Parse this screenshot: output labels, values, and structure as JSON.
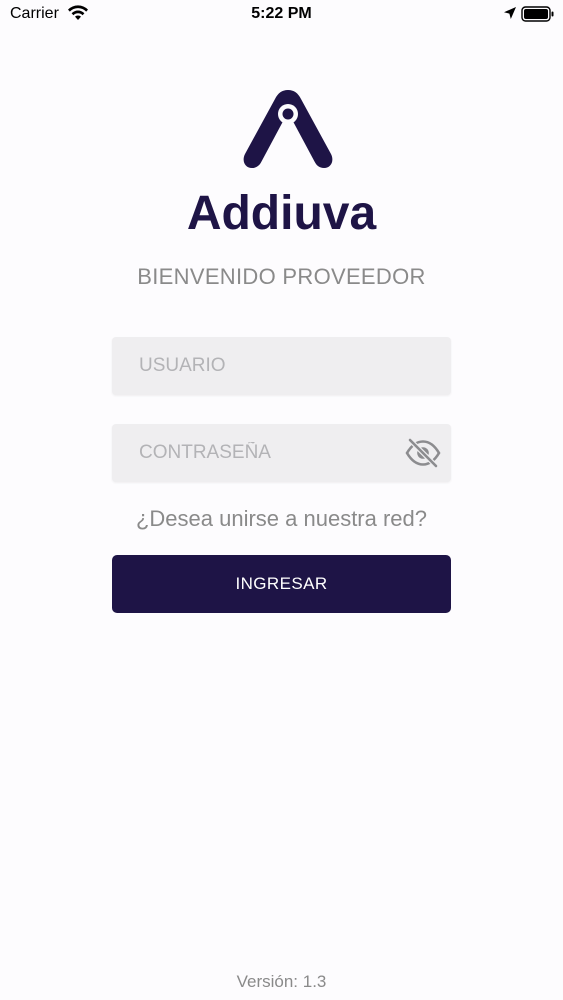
{
  "status_bar": {
    "carrier": "Carrier",
    "time": "5:22 PM",
    "icons": [
      "wifi-icon",
      "location-arrow-icon",
      "battery-icon"
    ]
  },
  "brand": {
    "name": "Addiuva",
    "color": "#1e1446",
    "logo_icon": "addiuva-logo-icon"
  },
  "welcome_text": "BIENVENIDO PROVEEDOR",
  "form": {
    "username_placeholder": "USUARIO",
    "username_value": "",
    "password_placeholder": "CONTRASEÑA",
    "password_value": "",
    "password_toggle_icon": "eye-slash-icon",
    "join_link": "¿Desea unirse a nuestra red?",
    "submit_label": "INGRESAR"
  },
  "version": "Versión: 1.3",
  "colors": {
    "primary": "#1e1446",
    "field_background": "#efeef0",
    "muted_text": "#8a8a8a",
    "background": "#fdfcfe"
  }
}
